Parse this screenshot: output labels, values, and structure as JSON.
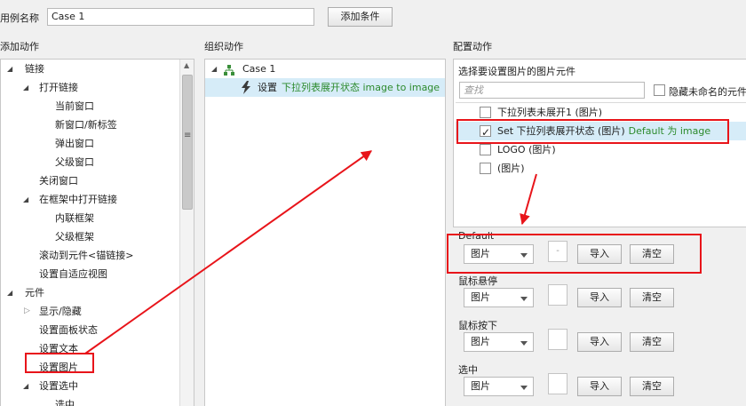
{
  "top": {
    "case_name_label": "用例名称",
    "case_name_value": "Case 1",
    "add_condition_label": "添加条件"
  },
  "left_panel": {
    "title": "添加动作",
    "items": [
      {
        "label": "链接"
      },
      {
        "label": "打开链接"
      },
      {
        "label": "当前窗口"
      },
      {
        "label": "新窗口/新标签"
      },
      {
        "label": "弹出窗口"
      },
      {
        "label": "父级窗口"
      },
      {
        "label": "关闭窗口"
      },
      {
        "label": "在框架中打开链接"
      },
      {
        "label": "内联框架"
      },
      {
        "label": "父级框架"
      },
      {
        "label": "滚动到元件<锚链接>"
      },
      {
        "label": "设置自适应视图"
      },
      {
        "label": "元件"
      },
      {
        "label": "显示/隐藏"
      },
      {
        "label": "设置面板状态"
      },
      {
        "label": "设置文本"
      },
      {
        "label": "设置图片"
      },
      {
        "label": "设置选中"
      },
      {
        "label": "选中"
      }
    ],
    "scroll_grip": "≡"
  },
  "middle_panel": {
    "title": "组织动作",
    "case_label": "Case 1",
    "action_prefix": "设置",
    "action_detail": "下拉列表展开状态 image to image"
  },
  "right_panel": {
    "title": "配置动作",
    "subtitle": "选择要设置图片的图片元件",
    "search_placeholder": "查找",
    "hide_unnamed_label": "隐藏未命名的元件",
    "widgets": [
      {
        "label": "下拉列表未展开1 (图片)",
        "detail": "",
        "checked": false
      },
      {
        "label": "Set 下拉列表展开状态 (图片)",
        "detail": "Default 为 image",
        "checked": true
      },
      {
        "label": "LOGO (图片)",
        "detail": "",
        "checked": false
      },
      {
        "label": "(图片)",
        "detail": "",
        "checked": false
      }
    ],
    "states": [
      {
        "label": "Default",
        "type": "图片",
        "thumb": "-",
        "import": "导入",
        "clear": "清空"
      },
      {
        "label": "鼠标悬停",
        "type": "图片",
        "thumb": "",
        "import": "导入",
        "clear": "清空"
      },
      {
        "label": "鼠标按下",
        "type": "图片",
        "thumb": "",
        "import": "导入",
        "clear": "清空"
      },
      {
        "label": "选中",
        "type": "图片",
        "thumb": "",
        "import": "导入",
        "clear": "清空"
      }
    ]
  },
  "colors": {
    "highlight": "#d6ecf8",
    "annotation_red": "#e8141a",
    "detail_green": "#2c8a2c"
  }
}
